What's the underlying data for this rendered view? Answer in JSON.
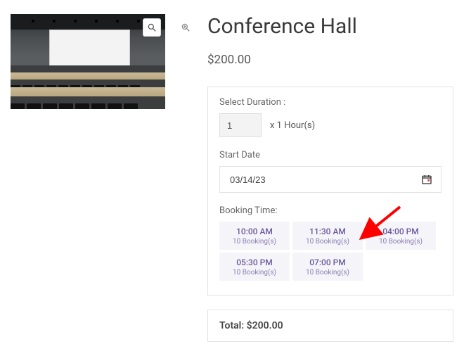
{
  "product": {
    "title": "Conference Hall",
    "price": "$200.00"
  },
  "duration": {
    "label": "Select Duration :",
    "value": "1",
    "suffix": "x 1 Hour(s)"
  },
  "start_date": {
    "label": "Start Date",
    "value": "03/14/23"
  },
  "booking_time": {
    "label": "Booking Time:",
    "slots": [
      {
        "time": "10:00 AM",
        "sub": "10 Booking(s)"
      },
      {
        "time": "11:30 AM",
        "sub": "10 Booking(s)"
      },
      {
        "time": "04:00 PM",
        "sub": "10 Booking(s)"
      },
      {
        "time": "05:30 PM",
        "sub": "10 Booking(s)"
      },
      {
        "time": "07:00 PM",
        "sub": "10 Booking(s)"
      }
    ]
  },
  "total": {
    "label": "Total:",
    "value": "$200.00"
  }
}
